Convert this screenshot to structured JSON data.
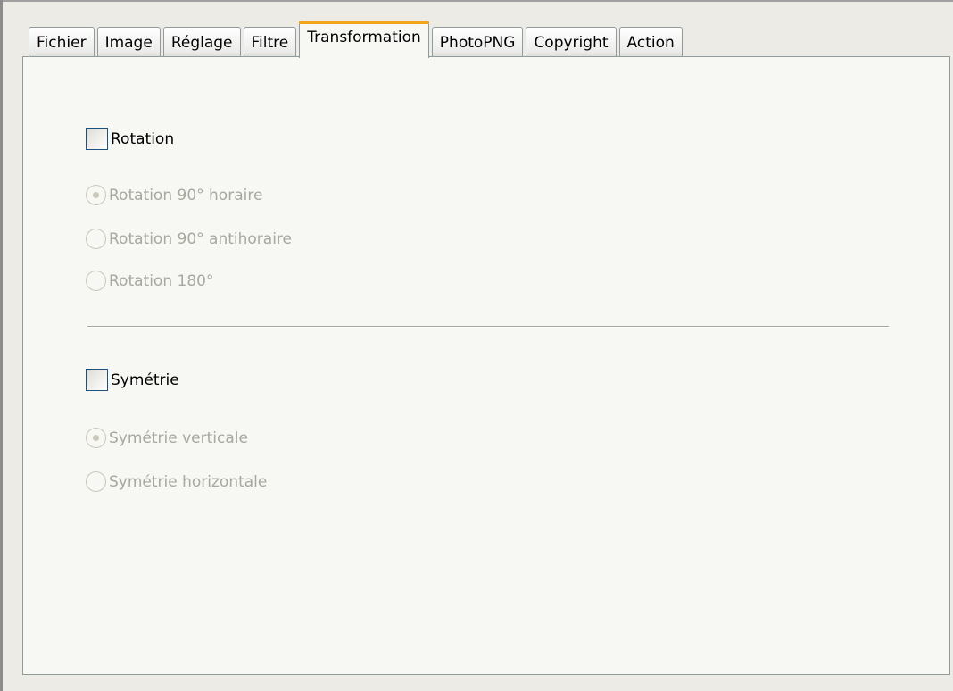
{
  "tabs": [
    {
      "label": "Fichier",
      "active": false
    },
    {
      "label": "Image",
      "active": false
    },
    {
      "label": "Réglage",
      "active": false
    },
    {
      "label": "Filtre",
      "active": false
    },
    {
      "label": "Transformation",
      "active": true
    },
    {
      "label": "PhotoPNG",
      "active": false
    },
    {
      "label": "Copyright",
      "active": false
    },
    {
      "label": "Action",
      "active": false
    }
  ],
  "rotation": {
    "checkbox_label": "Rotation",
    "checked": false,
    "options": [
      {
        "label": "Rotation 90° horaire",
        "selected": true
      },
      {
        "label": "Rotation 90° antihoraire",
        "selected": false
      },
      {
        "label": "Rotation 180°",
        "selected": false
      }
    ]
  },
  "symmetry": {
    "checkbox_label": "Symétrie",
    "checked": false,
    "options": [
      {
        "label": "Symétrie verticale",
        "selected": true
      },
      {
        "label": "Symétrie horizontale",
        "selected": false
      }
    ]
  },
  "colors": {
    "accent_tab": "#f3a41a",
    "disabled_text": "#a8a8a0",
    "checkbox_border": "#1c5180"
  }
}
